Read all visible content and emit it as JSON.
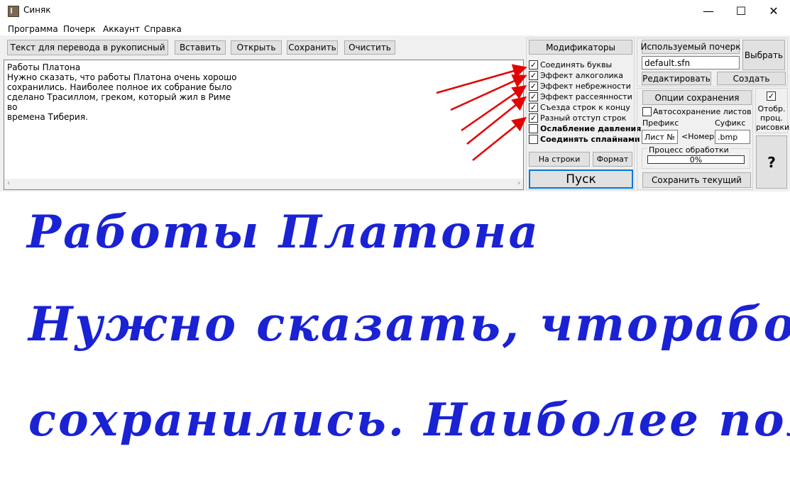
{
  "window": {
    "title": "Синяк",
    "minimize": "—",
    "maximize": "☐",
    "close": "✕"
  },
  "menu": [
    "Программа",
    "Почерк",
    "Аккаунт",
    "Справка"
  ],
  "toolbar": {
    "translate_button": "Текст для перевода в рукописный",
    "paste": "Вставить",
    "open": "Открыть",
    "save": "Сохранить",
    "clear": "Очистить"
  },
  "input_text": "Работы Платона\nНужно сказать, что работы Платона очень хорошо\nсохранились. Наиболее полное их собрание было\nсделано Трасиллом, греком, который жил в Риме во\nвремена Тиберия.",
  "modifiers": {
    "header": "Модификаторы",
    "items": [
      {
        "label": "Соединять буквы",
        "checked": true,
        "bold": false
      },
      {
        "label": "Эффект алкоголика",
        "checked": true,
        "bold": false
      },
      {
        "label": "Эффект небрежности",
        "checked": true,
        "bold": false
      },
      {
        "label": "Эффект рассеянности",
        "checked": true,
        "bold": false
      },
      {
        "label": "Съезда строк к концу",
        "checked": true,
        "bold": false
      },
      {
        "label": "Разный отступ строк",
        "checked": true,
        "bold": false
      },
      {
        "label": "Ослабление давления",
        "checked": false,
        "bold": true
      },
      {
        "label": "Соединять сплайнами",
        "checked": false,
        "bold": true
      }
    ],
    "to_lines": "На строки",
    "format": "Формат",
    "run": "Пуск"
  },
  "handwriting_font": {
    "header": "Используемый почерк",
    "file": "default.sfn",
    "choose": "Выбрать",
    "edit": "Редактировать",
    "create": "Создать"
  },
  "save_options": {
    "header": "Опции сохранения",
    "autosave_label": "Автосохранение листов",
    "autosave_checked": false,
    "prefix_label": "Префикс",
    "suffix_label": "Суфикс",
    "prefix_value": "Лист №",
    "number_placeholder": "<Номер>",
    "suffix_value": ".bmp",
    "progress_label": "Процесс обработки",
    "progress_text": "0%",
    "progress_value": 0,
    "save_current": "Сохранить текущий"
  },
  "show_drawing": {
    "label": "Отобр. проц. рисовки",
    "checked": true
  },
  "help_button": "?",
  "handwriting_output": [
    "Работы Платона",
    "Нужно сказать, чторабот",
    "сохранились. Наиболее пол"
  ],
  "colors": {
    "arrow": "#e30000",
    "ink": "#1a22d4"
  }
}
